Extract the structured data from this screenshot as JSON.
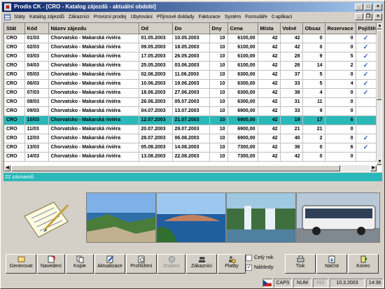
{
  "window": {
    "title": "Prodis CK - [CRO - Katalog zájezdů - aktuální období]"
  },
  "menu": [
    "Státy",
    "Katalog zájezdů",
    "Zákazníci",
    "Provizní prodej",
    "Ubytování",
    "Příjmové doklady",
    "Fakturace",
    "Systém",
    "Formuláře",
    "0 aplikaci"
  ],
  "table": {
    "columns": [
      "Stát",
      "Kód",
      "Název zájezdu",
      "Od",
      "Do",
      "Dny",
      "Cena",
      "Místa",
      "Volné",
      "Obsaz",
      "Rezervace",
      "Pojištěn"
    ],
    "rows": [
      {
        "stat": "CRO",
        "kod": "01/03",
        "nazev": "Chorvatsko - Makarská riviéra",
        "od": "01.05.2003",
        "do": "10.05.2003",
        "dny": "10",
        "cena": "6100,00",
        "mista": "42",
        "volne": "42",
        "obsaz": "0",
        "rez": "0",
        "poj": "✓"
      },
      {
        "stat": "CRO",
        "kod": "02/03",
        "nazev": "Chorvatsko - Makarská riviéra",
        "od": "09.05.2003",
        "do": "18.05.2003",
        "dny": "10",
        "cena": "6100,00",
        "mista": "42",
        "volne": "42",
        "obsaz": "0",
        "rez": "0",
        "poj": "✓"
      },
      {
        "stat": "CRO",
        "kod": "03/03",
        "nazev": "Chorvatsko - Makarská riviéra",
        "od": "17.05.2003",
        "do": "26.05.2003",
        "dny": "10",
        "cena": "6100,00",
        "mista": "42",
        "volne": "28",
        "obsaz": "9",
        "rez": "5",
        "poj": "✓"
      },
      {
        "stat": "CRO",
        "kod": "04/03",
        "nazev": "Chorvatsko - Makarská riviéra",
        "od": "25.05.2003",
        "do": "03.06.2003",
        "dny": "10",
        "cena": "6100,00",
        "mista": "42",
        "volne": "26",
        "obsaz": "14",
        "rez": "2",
        "poj": "✓"
      },
      {
        "stat": "CRO",
        "kod": "05/03",
        "nazev": "Chorvatsko - Makarská riviéra",
        "od": "02.06.2003",
        "do": "11.06.2003",
        "dny": "10",
        "cena": "6300,00",
        "mista": "42",
        "volne": "37",
        "obsaz": "5",
        "rez": "0",
        "poj": "✓"
      },
      {
        "stat": "CRO",
        "kod": "06/03",
        "nazev": "Chorvatsko - Makarská riviéra",
        "od": "10.06.2003",
        "do": "19.06.2003",
        "dny": "10",
        "cena": "6300,00",
        "mista": "42",
        "volne": "33",
        "obsaz": "5",
        "rez": "4",
        "poj": "✓"
      },
      {
        "stat": "CRO",
        "kod": "07/03",
        "nazev": "Chorvatsko - Makarská riviéra",
        "od": "18.06.2003",
        "do": "27.06.2003",
        "dny": "10",
        "cena": "6300,00",
        "mista": "42",
        "volne": "38",
        "obsaz": "4",
        "rez": "0",
        "poj": "✓"
      },
      {
        "stat": "CRO",
        "kod": "08/03",
        "nazev": "Chorvatsko - Makarská riviéra",
        "od": "26.06.2003",
        "do": "05.07.2003",
        "dny": "10",
        "cena": "6300,00",
        "mista": "42",
        "volne": "31",
        "obsaz": "11",
        "rez": "0",
        "poj": ""
      },
      {
        "stat": "CRO",
        "kod": "09/03",
        "nazev": "Chorvatsko - Makarská riviéra",
        "od": "04.07.2003",
        "do": "13.07.2003",
        "dny": "10",
        "cena": "6900,00",
        "mista": "42",
        "volne": "33",
        "obsaz": "9",
        "rez": "0",
        "poj": ""
      },
      {
        "stat": "CRO",
        "kod": "10/03",
        "nazev": "Chorvatsko - Makarská riviéra",
        "od": "12.07.2003",
        "do": "21.07.2003",
        "dny": "10",
        "cena": "6900,00",
        "mista": "42",
        "volne": "19",
        "obsaz": "17",
        "rez": "6",
        "poj": ""
      },
      {
        "stat": "CRO",
        "kod": "11/03",
        "nazev": "Chorvatsko - Makarská riviéra",
        "od": "20.07.2003",
        "do": "29.07.2003",
        "dny": "10",
        "cena": "6900,00",
        "mista": "42",
        "volne": "21",
        "obsaz": "21",
        "rez": "0",
        "poj": ""
      },
      {
        "stat": "CRO",
        "kod": "12/03",
        "nazev": "Chorvatsko - Makarská riviéra",
        "od": "28.07.2003",
        "do": "06.08.2003",
        "dny": "10",
        "cena": "6900,00",
        "mista": "42",
        "volne": "40",
        "obsaz": "2",
        "rez": "0",
        "poj": "✓"
      },
      {
        "stat": "CRO",
        "kod": "13/03",
        "nazev": "Chorvatsko - Makarská riviéra",
        "od": "05.08.2003",
        "do": "14.08.2003",
        "dny": "10",
        "cena": "7300,00",
        "mista": "42",
        "volne": "36",
        "obsaz": "0",
        "rez": "6",
        "poj": "✓"
      },
      {
        "stat": "CRO",
        "kod": "14/03",
        "nazev": "Chorvatsko - Makarská riviéra",
        "od": "13.08.2003",
        "do": "22.08.2003",
        "dny": "10",
        "cena": "7300,00",
        "mista": "42",
        "volne": "42",
        "obsaz": "0",
        "rez": "0",
        "poj": ""
      }
    ],
    "selected_index": 9
  },
  "record_count": "22 záznamů",
  "buttons": [
    "Generovat",
    "Navedení",
    "Kopie",
    "Aktualizace",
    "Prohlížení",
    "Zrušení",
    "Zákazníci",
    "Platby",
    "Tisk",
    "Načíst",
    "Konec"
  ],
  "checkboxes": {
    "celyrok": "Celý rok",
    "nahledy": "Náhledy",
    "nahledy_checked": "✓"
  },
  "status": {
    "caps": "CAPS",
    "num": "NUM",
    "ins": "INS",
    "date": "10.3.2003",
    "time": "14:36"
  },
  "colors": {
    "selection": "#2bb8b8",
    "title_start": "#0a246a",
    "title_end": "#a6caf0",
    "check": "#2050c0"
  }
}
